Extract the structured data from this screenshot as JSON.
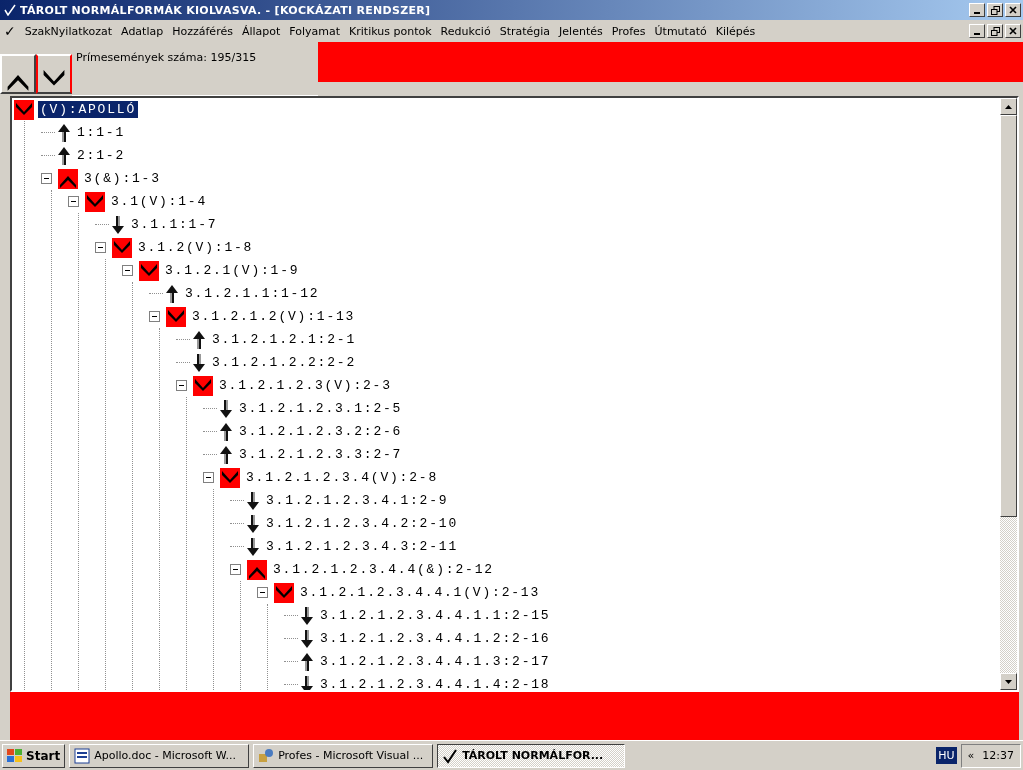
{
  "window": {
    "title": "TÁROLT NORMÁLFORMÁK KIOLVASVA. - [KOCKÁZATI RENDSZER]"
  },
  "menu": {
    "check_mark": "✓",
    "items": [
      "SzakNyilatkozat",
      "Adatlap",
      "Hozzáférés",
      "Állapot",
      "Folyamat",
      "Kritikus pontok",
      "Redukció",
      "Stratégia",
      "Jelentés",
      "Profes",
      "Útmutató",
      "Kilépés"
    ]
  },
  "toolbar": {
    "status": "Prímesemények száma: 195/315"
  },
  "tree": {
    "nodes": [
      {
        "label": "(V):APOLLÓ",
        "kind": "or",
        "selected": true,
        "children": [
          {
            "label": "1:1-1",
            "kind": "up",
            "selected": false
          },
          {
            "label": "2:1-2",
            "kind": "up",
            "selected": false
          },
          {
            "label": "3(&):1-3",
            "kind": "and",
            "selected": false,
            "expanded": true,
            "children": [
              {
                "label": "3.1(V):1-4",
                "kind": "or",
                "selected": false,
                "expanded": true,
                "children": [
                  {
                    "label": "3.1.1:1-7",
                    "kind": "down",
                    "selected": false
                  },
                  {
                    "label": "3.1.2(V):1-8",
                    "kind": "or",
                    "selected": false,
                    "expanded": true,
                    "children": [
                      {
                        "label": "3.1.2.1(V):1-9",
                        "kind": "or",
                        "selected": false,
                        "expanded": true,
                        "children": [
                          {
                            "label": "3.1.2.1.1:1-12",
                            "kind": "up",
                            "selected": false
                          },
                          {
                            "label": "3.1.2.1.2(V):1-13",
                            "kind": "or",
                            "selected": false,
                            "expanded": true,
                            "children": [
                              {
                                "label": "3.1.2.1.2.1:2-1",
                                "kind": "up",
                                "selected": false
                              },
                              {
                                "label": "3.1.2.1.2.2:2-2",
                                "kind": "down",
                                "selected": false
                              },
                              {
                                "label": "3.1.2.1.2.3(V):2-3",
                                "kind": "or",
                                "selected": false,
                                "expanded": true,
                                "children": [
                                  {
                                    "label": "3.1.2.1.2.3.1:2-5",
                                    "kind": "down",
                                    "selected": false
                                  },
                                  {
                                    "label": "3.1.2.1.2.3.2:2-6",
                                    "kind": "up",
                                    "selected": false
                                  },
                                  {
                                    "label": "3.1.2.1.2.3.3:2-7",
                                    "kind": "up",
                                    "selected": false
                                  },
                                  {
                                    "label": "3.1.2.1.2.3.4(V):2-8",
                                    "kind": "or",
                                    "selected": false,
                                    "expanded": true,
                                    "children": [
                                      {
                                        "label": "3.1.2.1.2.3.4.1:2-9",
                                        "kind": "down",
                                        "selected": false
                                      },
                                      {
                                        "label": "3.1.2.1.2.3.4.2:2-10",
                                        "kind": "down",
                                        "selected": false
                                      },
                                      {
                                        "label": "3.1.2.1.2.3.4.3:2-11",
                                        "kind": "down",
                                        "selected": false
                                      },
                                      {
                                        "label": "3.1.2.1.2.3.4.4(&):2-12",
                                        "kind": "and",
                                        "selected": false,
                                        "expanded": true,
                                        "children": [
                                          {
                                            "label": "3.1.2.1.2.3.4.4.1(V):2-13",
                                            "kind": "or",
                                            "selected": false,
                                            "expanded": true,
                                            "children": [
                                              {
                                                "label": "3.1.2.1.2.3.4.4.1.1:2-15",
                                                "kind": "down",
                                                "selected": false
                                              },
                                              {
                                                "label": "3.1.2.1.2.3.4.4.1.2:2-16",
                                                "kind": "down",
                                                "selected": false
                                              },
                                              {
                                                "label": "3.1.2.1.2.3.4.4.1.3:2-17",
                                                "kind": "up",
                                                "selected": false
                                              },
                                              {
                                                "label": "3.1.2.1.2.3.4.4.1.4:2-18",
                                                "kind": "down",
                                                "selected": false
                                              }
                                            ]
                                          }
                                        ]
                                      }
                                    ]
                                  }
                                ]
                              }
                            ]
                          }
                        ]
                      }
                    ]
                  }
                ]
              }
            ]
          }
        ]
      }
    ]
  },
  "taskbar": {
    "start": "Start",
    "tasks": [
      {
        "label": "Apollo.doc - Microsoft W...",
        "kind": "doc",
        "selected": false
      },
      {
        "label": "Profes - Microsoft Visual ...",
        "kind": "vb",
        "selected": false
      },
      {
        "label": "TÁROLT NORMÁLFOR...",
        "kind": "check",
        "selected": true
      }
    ],
    "language": "HU",
    "tray_toggle": "«",
    "clock": "12:37"
  }
}
